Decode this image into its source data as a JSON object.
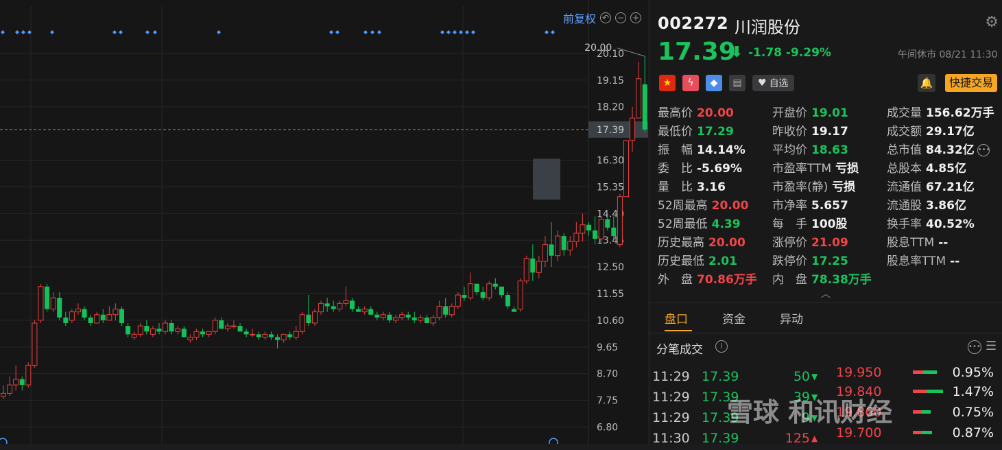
{
  "chart_toolbar": {
    "adjust_label": "前复权",
    "zoom_out": "−",
    "zoom_in": "+"
  },
  "stock": {
    "code": "002272",
    "name": "川润股份",
    "price": "17.39",
    "change": "-1.78",
    "change_pct": "-9.29%",
    "status": "午间休市 08/21 11:30",
    "watchlist_label": "自选",
    "quick_trade_label": "快捷交易"
  },
  "stats": [
    [
      {
        "label": "最高价",
        "value": "20.00",
        "color": "red"
      },
      {
        "label": "开盘价",
        "value": "19.01",
        "color": "green"
      },
      {
        "label": "成交量",
        "value": "156.62万手",
        "color": "white"
      }
    ],
    [
      {
        "label": "最低价",
        "value": "17.29",
        "color": "green"
      },
      {
        "label": "昨收价",
        "value": "19.17",
        "color": "white"
      },
      {
        "label": "成交额",
        "value": "29.17亿",
        "color": "white"
      }
    ],
    [
      {
        "label": "振　幅",
        "value": "14.14%",
        "color": "white"
      },
      {
        "label": "平均价",
        "value": "18.63",
        "color": "green"
      },
      {
        "label": "总市值",
        "value": "84.32亿",
        "color": "white"
      }
    ],
    [
      {
        "label": "委　比",
        "value": "-5.69%",
        "color": "white"
      },
      {
        "label": "市盈率TTM",
        "value": "亏损",
        "color": "white"
      },
      {
        "label": "总股本",
        "value": "4.85亿",
        "color": "white"
      }
    ],
    [
      {
        "label": "量　比",
        "value": "3.16",
        "color": "white"
      },
      {
        "label": "市盈率(静)",
        "value": "亏损",
        "color": "white"
      },
      {
        "label": "流通值",
        "value": "67.21亿",
        "color": "white"
      }
    ],
    [
      {
        "label": "52周最高",
        "value": "20.00",
        "color": "red"
      },
      {
        "label": "市净率",
        "value": "5.657",
        "color": "white"
      },
      {
        "label": "流通股",
        "value": "3.86亿",
        "color": "white"
      }
    ],
    [
      {
        "label": "52周最低",
        "value": "4.39",
        "color": "green"
      },
      {
        "label": "每　手",
        "value": "100股",
        "color": "white"
      },
      {
        "label": "换手率",
        "value": "40.52%",
        "color": "white"
      }
    ],
    [
      {
        "label": "历史最高",
        "value": "20.00",
        "color": "red"
      },
      {
        "label": "涨停价",
        "value": "21.09",
        "color": "red"
      },
      {
        "label": "股息TTM",
        "value": "--",
        "color": "white"
      }
    ],
    [
      {
        "label": "历史最低",
        "value": "2.01",
        "color": "green"
      },
      {
        "label": "跌停价",
        "value": "17.25",
        "color": "green"
      },
      {
        "label": "股息率TTM",
        "value": "--",
        "color": "white"
      }
    ],
    [
      {
        "label": "外　盘",
        "value": "70.86万手",
        "color": "red"
      },
      {
        "label": "内　盘",
        "value": "78.38万手",
        "color": "green"
      },
      {
        "label": "",
        "value": "",
        "color": "white"
      }
    ]
  ],
  "tabs": [
    "盘口",
    "资金",
    "异动"
  ],
  "ticks_section": {
    "title": "分笔成交"
  },
  "trades": [
    {
      "time": "11:29",
      "price": "17.39",
      "vol": "50",
      "dir": "down"
    },
    {
      "time": "11:29",
      "price": "17.39",
      "vol": "39",
      "dir": "down"
    },
    {
      "time": "11:29",
      "price": "17.39",
      "vol": "9",
      "dir": "down"
    },
    {
      "time": "11:30",
      "price": "17.39",
      "vol": "125",
      "dir": "up"
    }
  ],
  "price_levels": [
    {
      "price": "19.950",
      "pct": "0.95%",
      "red": 0.35,
      "green": 0.45
    },
    {
      "price": "19.840",
      "pct": "1.47%",
      "red": 0.45,
      "green": 0.55
    },
    {
      "price": "19.860",
      "pct": "0.75%",
      "red": 0.3,
      "green": 0.3
    },
    {
      "price": "19.700",
      "pct": "0.87%",
      "red": 0.3,
      "green": 0.35
    }
  ],
  "watermark": "雪球 和讯财经",
  "chart_data": {
    "type": "candlestick",
    "ylim": [
      6.3,
      20.6
    ],
    "yticks": [
      "20.10",
      "19.15",
      "18.20",
      "17.39",
      "16.30",
      "15.35",
      "14.40",
      "13.45",
      "12.50",
      "11.55",
      "10.60",
      "9.65",
      "8.70",
      "7.75",
      "6.80"
    ],
    "current_price": 17.39,
    "max_label": "20.00",
    "candles": [
      [
        7.9,
        8.3,
        7.8,
        8.0
      ],
      [
        8.0,
        8.6,
        7.9,
        8.3
      ],
      [
        8.3,
        9.0,
        8.1,
        8.5
      ],
      [
        8.5,
        8.6,
        8.1,
        8.3
      ],
      [
        8.3,
        9.1,
        8.2,
        9.0
      ],
      [
        9.0,
        10.6,
        8.9,
        10.5
      ],
      [
        10.6,
        11.9,
        10.5,
        11.8
      ],
      [
        11.8,
        11.9,
        10.9,
        11.0
      ],
      [
        11.0,
        11.6,
        10.9,
        11.4
      ],
      [
        11.4,
        11.6,
        10.6,
        10.7
      ],
      [
        10.7,
        10.9,
        10.4,
        10.5
      ],
      [
        10.6,
        11.0,
        10.5,
        10.9
      ],
      [
        10.9,
        11.2,
        10.8,
        11.0
      ],
      [
        11.0,
        11.1,
        10.6,
        10.7
      ],
      [
        10.7,
        10.8,
        10.4,
        10.5
      ],
      [
        10.5,
        10.9,
        10.5,
        10.8
      ],
      [
        10.8,
        11.0,
        10.5,
        10.6
      ],
      [
        10.6,
        11.1,
        10.6,
        10.8
      ],
      [
        10.8,
        11.2,
        10.6,
        11.0
      ],
      [
        11.0,
        11.1,
        10.4,
        10.5
      ],
      [
        10.4,
        10.5,
        10.0,
        10.1
      ],
      [
        10.0,
        10.2,
        9.9,
        10.1
      ],
      [
        10.1,
        10.5,
        10.0,
        10.4
      ],
      [
        10.4,
        10.6,
        10.1,
        10.2
      ],
      [
        10.1,
        10.4,
        10.0,
        10.3
      ],
      [
        10.3,
        10.5,
        10.1,
        10.2
      ],
      [
        10.2,
        10.6,
        10.1,
        10.5
      ],
      [
        10.5,
        10.6,
        10.1,
        10.2
      ],
      [
        10.2,
        10.4,
        10.1,
        10.3
      ],
      [
        10.3,
        10.4,
        10.0,
        10.0
      ],
      [
        9.9,
        10.1,
        9.8,
        10.0
      ],
      [
        10.0,
        10.3,
        9.9,
        10.2
      ],
      [
        10.2,
        10.3,
        10.0,
        10.1
      ],
      [
        10.1,
        10.2,
        10.0,
        10.2
      ],
      [
        10.2,
        10.7,
        10.1,
        10.6
      ],
      [
        10.6,
        10.7,
        10.3,
        10.3
      ],
      [
        10.3,
        10.5,
        10.2,
        10.4
      ],
      [
        10.4,
        10.6,
        10.3,
        10.4
      ],
      [
        10.4,
        10.5,
        10.2,
        10.2
      ],
      [
        10.2,
        10.3,
        10.0,
        10.1
      ],
      [
        10.1,
        10.3,
        10.0,
        10.1
      ],
      [
        10.1,
        10.2,
        9.9,
        10.0
      ],
      [
        10.0,
        10.2,
        9.9,
        10.1
      ],
      [
        10.1,
        10.2,
        9.9,
        10.0
      ],
      [
        10.0,
        10.1,
        9.6,
        9.9
      ],
      [
        9.9,
        10.1,
        9.8,
        10.1
      ],
      [
        10.1,
        10.2,
        9.9,
        10.0
      ],
      [
        10.0,
        10.4,
        9.9,
        10.2
      ],
      [
        10.2,
        10.9,
        10.1,
        10.8
      ],
      [
        10.8,
        11.5,
        10.4,
        10.5
      ],
      [
        10.5,
        11.0,
        10.4,
        10.9
      ],
      [
        10.9,
        11.3,
        10.8,
        11.2
      ],
      [
        11.2,
        11.4,
        10.9,
        11.1
      ],
      [
        11.1,
        11.3,
        10.9,
        11.0
      ],
      [
        11.0,
        11.3,
        10.9,
        11.2
      ],
      [
        11.2,
        11.8,
        11.1,
        11.3
      ],
      [
        11.3,
        11.4,
        10.9,
        11.0
      ],
      [
        11.0,
        11.1,
        10.9,
        10.9
      ],
      [
        10.9,
        11.1,
        10.8,
        11.0
      ],
      [
        11.0,
        11.1,
        10.8,
        10.8
      ],
      [
        10.8,
        10.9,
        10.6,
        10.7
      ],
      [
        10.7,
        10.9,
        10.6,
        10.8
      ],
      [
        10.8,
        10.9,
        10.5,
        10.6
      ],
      [
        10.6,
        10.8,
        10.5,
        10.7
      ],
      [
        10.7,
        10.9,
        10.6,
        10.8
      ],
      [
        10.8,
        10.9,
        10.6,
        10.7
      ],
      [
        10.7,
        10.9,
        10.5,
        10.6
      ],
      [
        10.6,
        10.8,
        10.5,
        10.7
      ],
      [
        10.7,
        10.8,
        10.5,
        10.5
      ],
      [
        10.5,
        10.8,
        10.4,
        10.7
      ],
      [
        10.7,
        11.3,
        10.6,
        11.1
      ],
      [
        11.1,
        11.4,
        10.7,
        10.8
      ],
      [
        10.8,
        11.2,
        10.7,
        11.1
      ],
      [
        11.1,
        11.6,
        11.0,
        11.5
      ],
      [
        11.5,
        11.8,
        11.3,
        11.4
      ],
      [
        11.4,
        12.3,
        11.3,
        11.9
      ],
      [
        11.9,
        11.9,
        11.5,
        11.6
      ],
      [
        11.6,
        11.8,
        11.3,
        11.4
      ],
      [
        11.4,
        12.0,
        11.3,
        11.9
      ],
      [
        11.9,
        12.1,
        11.7,
        11.8
      ],
      [
        11.8,
        11.8,
        11.4,
        11.5
      ],
      [
        11.5,
        11.6,
        11.0,
        11.1
      ],
      [
        11.0,
        11.1,
        10.9,
        10.9
      ],
      [
        11.0,
        12.1,
        10.9,
        12.0
      ],
      [
        12.0,
        12.9,
        11.9,
        12.8
      ],
      [
        12.8,
        13.3,
        12.0,
        12.3
      ],
      [
        12.3,
        12.9,
        12.1,
        12.7
      ],
      [
        12.7,
        13.6,
        12.5,
        13.3
      ],
      [
        13.3,
        14.1,
        12.5,
        12.9
      ],
      [
        12.9,
        13.8,
        12.7,
        13.6
      ],
      [
        13.6,
        13.7,
        12.9,
        13.1
      ],
      [
        13.1,
        13.6,
        12.9,
        13.4
      ],
      [
        13.4,
        14.1,
        13.2,
        13.7
      ],
      [
        13.7,
        14.4,
        13.4,
        14.0
      ],
      [
        14.0,
        14.1,
        13.6,
        13.8
      ],
      [
        13.8,
        14.3,
        13.3,
        13.5
      ],
      [
        13.5,
        14.3,
        13.4,
        14.2
      ],
      [
        14.2,
        14.3,
        13.8,
        13.9
      ],
      [
        13.9,
        14.3,
        13.5,
        13.6
      ],
      [
        13.3,
        15.1,
        13.2,
        15.0
      ],
      [
        15.0,
        17.0,
        15.0,
        17.0
      ],
      [
        17.0,
        18.2,
        16.6,
        17.8
      ],
      [
        17.8,
        19.8,
        17.8,
        19.2
      ],
      [
        19.0,
        20.0,
        17.3,
        17.39
      ]
    ]
  }
}
